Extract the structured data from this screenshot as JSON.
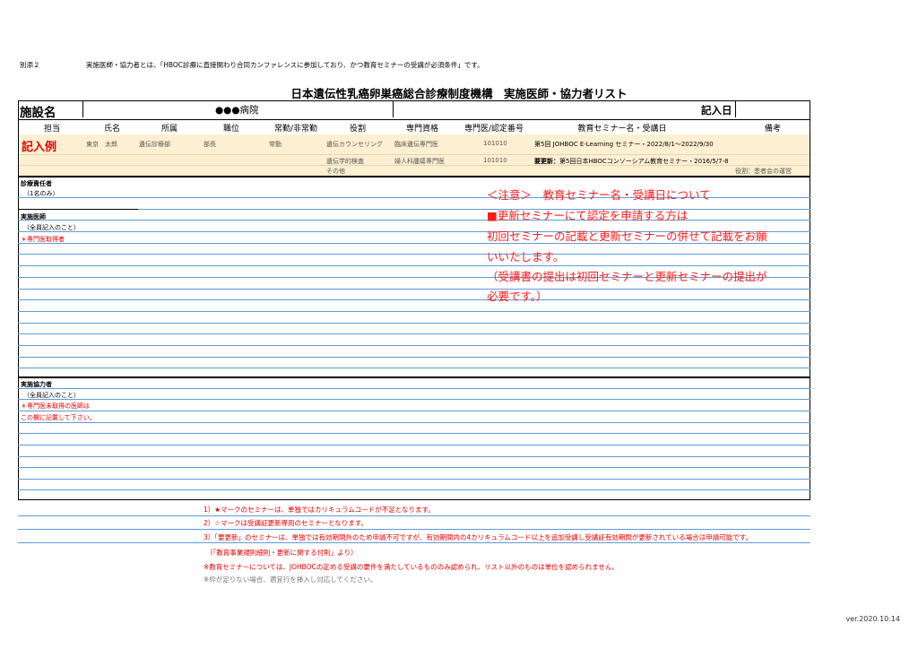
{
  "header": {
    "attachment": "別添２",
    "note": "実施医師・協力者とは、「HBOC診療に直接関わり合同カンファレンスに参加しており、かつ教育セミナーの受講が必須条件」です。"
  },
  "title": "日本遺伝性乳癌卵巣癌総合診療制度機構　実施医師・協力者リスト",
  "facility": {
    "label": "施設名",
    "name_dots": "●●●",
    "name_suffix": "病院",
    "date_label": "記入日",
    "date_value": ""
  },
  "columns": [
    "担当",
    "氏名",
    "所属",
    "職位",
    "常勤/非常勤",
    "役割",
    "専門資格",
    "専門医/認定番号",
    "教育セミナー名・受講日",
    "備考"
  ],
  "example": {
    "title": "記入例",
    "rows": [
      {
        "name": "東京　太郎",
        "dept": "遺伝診療部",
        "position": "部長",
        "status": "常勤",
        "role": "遺伝カウンセリング",
        "qualification": "臨床遺伝専門医",
        "number": "101010",
        "seminar": "第5回 JOHBOC E-Learning セミナー・2022/8/1～2022/9/30"
      },
      {
        "role": "遺伝学的検査",
        "qualification": "婦人科腫瘍専門医",
        "number": "101010",
        "seminar_prefix": "要更新：",
        "seminar": "第5回日本HBOCコンソーシアム教育セミナー・2016/5/7-8"
      },
      {
        "role": "その他",
        "remark": "役割：患者会の運営"
      }
    ]
  },
  "sections": {
    "director": {
      "title": "診療責任者",
      "note": "（1名のみ）"
    },
    "doctors": {
      "title": "実施医師",
      "note": "（全員記入のこと）",
      "red": "＊専門医取得者"
    },
    "cooperators": {
      "title": "実施協力者",
      "note": "（全員記入のこと）",
      "red1": "＊専門医未取得の医師は",
      "red2": "この欄に記載して下さい。"
    }
  },
  "notice": {
    "line1": "＜注意＞　教育セミナー名・受講日について",
    "line2": "■更新セミナーにて認定を申請する方は",
    "line3": "初回セミナーの記載と更新セミナーの併せて記載をお願",
    "line4": "いいたします。",
    "line5": "（受講書の提出は初回セミナーと更新セミナーの提出が",
    "line6": "必要です。）"
  },
  "footnotes": {
    "f1": "1）★マークのセミナーは、単独ではカリキュラムコードが不足となります。",
    "f2": "2）☆マークは受講証更新専用のセミナーとなります。",
    "f3": "3）「要更新」のセミナーは、単独では有効期間外のため申請不可ですが、有効期間内の4カリキュラムコード以上を追加受講し受講証有効期間が更新されている場合は申請可能です。",
    "f4": "（「教育事業規則細則・更新に関する付則」より）",
    "f5": "※教育セミナーについては、JOHBOCの定める受講の要件を満たしているもののみ認められ、リスト以外のものは単位を認められません。",
    "f6": "※枠が足りない場合、適宜行を挿入し対応してください。"
  },
  "version": "ver.2020.10.14",
  "colors": {
    "red": "#e00000",
    "blue_line": "#5b9bd5",
    "example_bg": "#fdf0d2"
  }
}
